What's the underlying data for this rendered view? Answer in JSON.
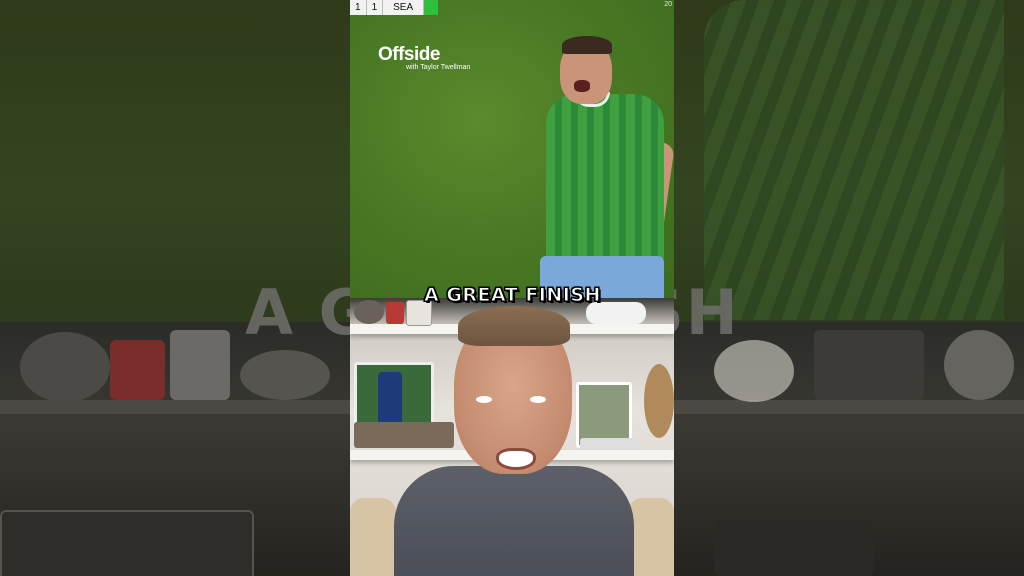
{
  "scoreboard": {
    "home_score": "1",
    "away_score": "1",
    "team": "SEA",
    "clock": "20"
  },
  "brand": {
    "name": "Offside",
    "subtitle": "with Taylor Twellman"
  },
  "caption": {
    "text": "A GREAT FINISH"
  },
  "background_text": {
    "left": "A G",
    "right": "ISH"
  },
  "colors": {
    "pitch": "#4a7a24",
    "jersey": "#3fa040",
    "caption_text": "#ffffff",
    "score_flag": "#2fbf3a"
  }
}
